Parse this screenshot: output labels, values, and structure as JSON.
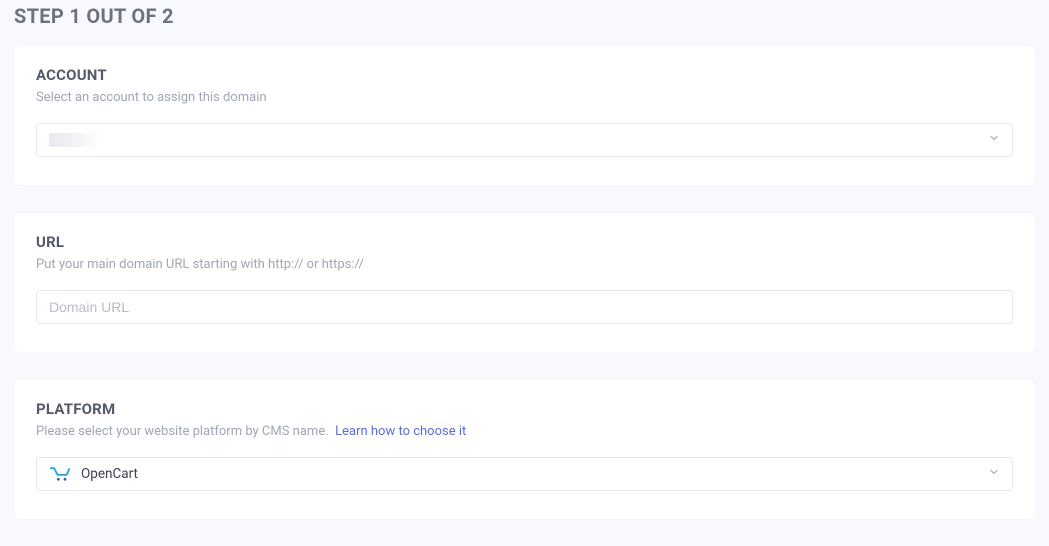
{
  "page": {
    "title": "STEP 1 OUT OF 2"
  },
  "account": {
    "title": "ACCOUNT",
    "subtitle": "Select an account to assign this domain",
    "selected": ""
  },
  "url": {
    "title": "URL",
    "subtitle": "Put your main domain URL starting with http:// or https://",
    "placeholder": "Domain URL",
    "value": ""
  },
  "platform": {
    "title": "PLATFORM",
    "subtitle_text": "Please select your website platform by CMS name.",
    "learn_link": "Learn how to choose it",
    "selected": "OpenCart",
    "icon": "cart-icon"
  }
}
